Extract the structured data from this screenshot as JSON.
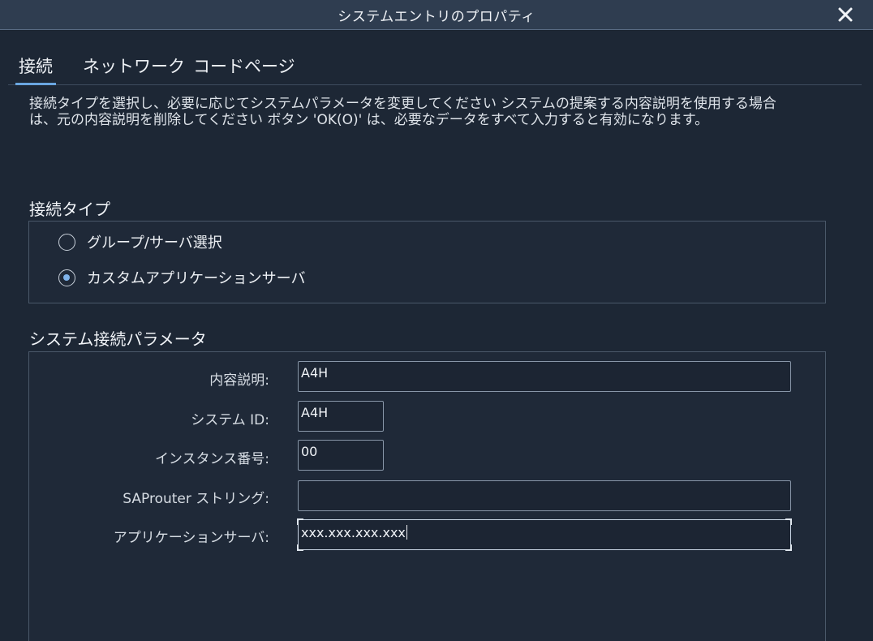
{
  "window": {
    "title": "システムエントリのプロパティ",
    "close_icon": "close-icon"
  },
  "tabs": [
    {
      "label": "接続",
      "active": true
    },
    {
      "label": "ネットワーク",
      "active": false
    },
    {
      "label": "コードページ",
      "active": false
    }
  ],
  "description": {
    "line1": "接続タイプを選択し、必要に応じてシステムパラメータを変更してください システムの提案する内容説明を使用する場合",
    "line2": "は、元の内容説明を削除してください ボタン 'OK(O)' は、必要なデータをすべて入力すると有効になります。"
  },
  "connection_type": {
    "title": "接続タイプ",
    "options": [
      {
        "label": "グループ/サーバ選択",
        "selected": false
      },
      {
        "label": "カスタムアプリケーションサーバ",
        "selected": true
      }
    ]
  },
  "parameters": {
    "title": "システム接続パラメータ",
    "fields": [
      {
        "label": "内容説明:",
        "value": "A4H"
      },
      {
        "label": "システム ID:",
        "value": "A4H"
      },
      {
        "label": "インスタンス番号:",
        "value": "00"
      },
      {
        "label": "SAProuter ストリング:",
        "value": ""
      },
      {
        "label": "アプリケーションサーバ:",
        "value": "xxx.xxx.xxx.xxx"
      }
    ]
  },
  "colors": {
    "background": "#1d2735",
    "titlebar": "#2f3d50",
    "accent": "#6aa6e0"
  }
}
